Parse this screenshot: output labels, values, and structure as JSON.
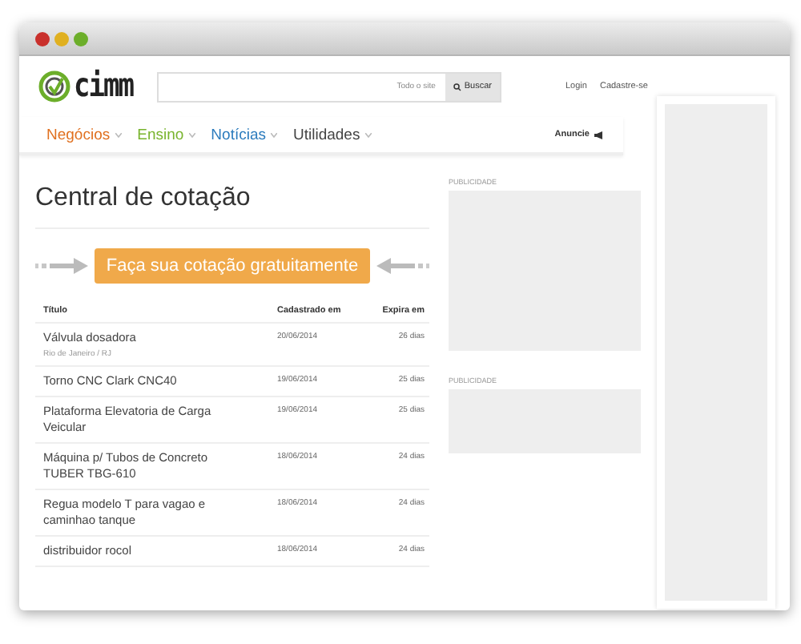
{
  "header": {
    "logo": "cimm",
    "search": {
      "scope": "Todo o site",
      "button": "Buscar"
    },
    "links": [
      "Login",
      "Cadastre-se"
    ]
  },
  "nav": [
    {
      "label": "Negócios",
      "color": "#e0701f"
    },
    {
      "label": "Ensino",
      "color": "#79b42e"
    },
    {
      "label": "Notícias",
      "color": "#2b7bbd"
    },
    {
      "label": "Utilidades",
      "color": "#444444"
    }
  ],
  "advertise": "Anuncie",
  "page_title": "Central de cotação",
  "cta": "Faça sua cotação gratuitamente",
  "table": {
    "columns": [
      "Título",
      "Cadastrado em",
      "Expira em"
    ],
    "rows": [
      {
        "title": "Válvula dosadora",
        "location": "Rio de Janeiro / RJ",
        "date": "20/06/2014",
        "expires": "26 dias"
      },
      {
        "title": "Torno CNC Clark CNC40",
        "date": "19/06/2014",
        "expires": "25 dias"
      },
      {
        "title": "Plataforma Elevatoria de Carga Veicular",
        "date": "19/06/2014",
        "expires": "25 dias"
      },
      {
        "title": "Máquina p/ Tubos de Concreto TUBER TBG-610",
        "date": "18/06/2014",
        "expires": "24 dias"
      },
      {
        "title": "Regua modelo T para vagao e caminhao tanque",
        "date": "18/06/2014",
        "expires": "24 dias"
      },
      {
        "title": "distribuidor rocol",
        "date": "18/06/2014",
        "expires": "24 dias"
      }
    ]
  },
  "ads": [
    "PUBLICIDADE",
    "PUBLICIDADE"
  ]
}
